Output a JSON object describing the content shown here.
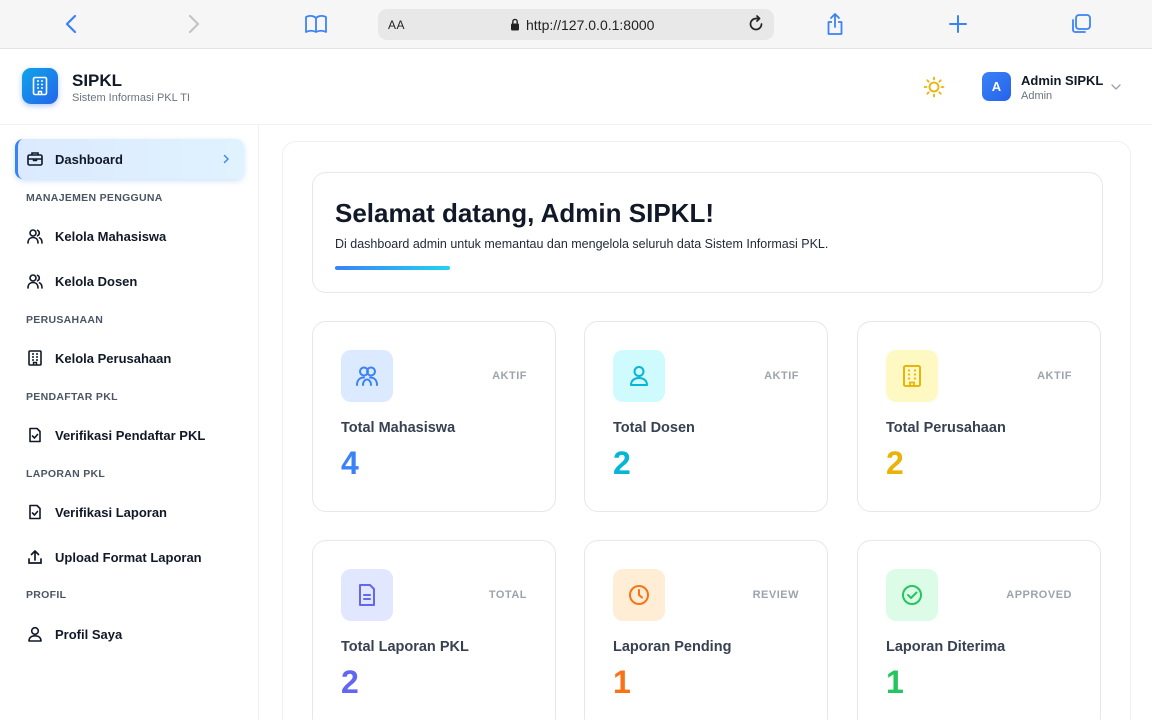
{
  "browser": {
    "text_size_label": "AA",
    "url": "http://127.0.0.1:8000"
  },
  "brand": {
    "title": "SIPKL",
    "subtitle": "Sistem Informasi PKL TI"
  },
  "user": {
    "initial": "A",
    "name": "Admin SIPKL",
    "role": "Admin"
  },
  "sidebar": {
    "active": {
      "label": "Dashboard",
      "icon": "dashboard-icon"
    },
    "sections": [
      {
        "title": "MANAJEMEN PENGGUNA",
        "items": [
          {
            "label": "Kelola Mahasiswa",
            "icon": "users-icon"
          },
          {
            "label": "Kelola Dosen",
            "icon": "users-icon"
          }
        ]
      },
      {
        "title": "PERUSAHAAN",
        "items": [
          {
            "label": "Kelola Perusahaan",
            "icon": "building-icon"
          }
        ]
      },
      {
        "title": "PENDAFTAR PKL",
        "items": [
          {
            "label": "Verifikasi Pendaftar PKL",
            "icon": "file-check-icon"
          }
        ]
      },
      {
        "title": "LAPORAN PKL",
        "items": [
          {
            "label": "Verifikasi Laporan",
            "icon": "file-check-icon"
          },
          {
            "label": "Upload Format Laporan",
            "icon": "upload-icon"
          }
        ]
      },
      {
        "title": "PROFIL",
        "items": [
          {
            "label": "Profil Saya",
            "icon": "user-icon"
          }
        ]
      }
    ]
  },
  "welcome": {
    "title": "Selamat datang, Admin SIPKL!",
    "subtitle": "Di dashboard admin untuk memantau dan mengelola seluruh data Sistem Informasi PKL."
  },
  "cards": [
    {
      "title": "Total Mahasiswa",
      "value": "4",
      "badge": "AKTIF",
      "icon": "users-icon",
      "color": "#3b82f6",
      "bg": "#dbeafe"
    },
    {
      "title": "Total Dosen",
      "value": "2",
      "badge": "AKTIF",
      "icon": "user-icon",
      "color": "#06b6d4",
      "bg": "#cffafe"
    },
    {
      "title": "Total Perusahaan",
      "value": "2",
      "badge": "AKTIF",
      "icon": "building-icon",
      "color": "#eab308",
      "bg": "#fef9c3"
    },
    {
      "title": "Total Laporan PKL",
      "value": "2",
      "badge": "TOTAL",
      "icon": "document-icon",
      "color": "#6366f1",
      "bg": "#e0e7ff"
    },
    {
      "title": "Laporan Pending",
      "value": "1",
      "badge": "REVIEW",
      "icon": "clock-icon",
      "color": "#f97316",
      "bg": "#ffedd5"
    },
    {
      "title": "Laporan Diterima",
      "value": "1",
      "badge": "APPROVED",
      "icon": "check-circle-icon",
      "color": "#22c55e",
      "bg": "#dcfce7"
    }
  ]
}
